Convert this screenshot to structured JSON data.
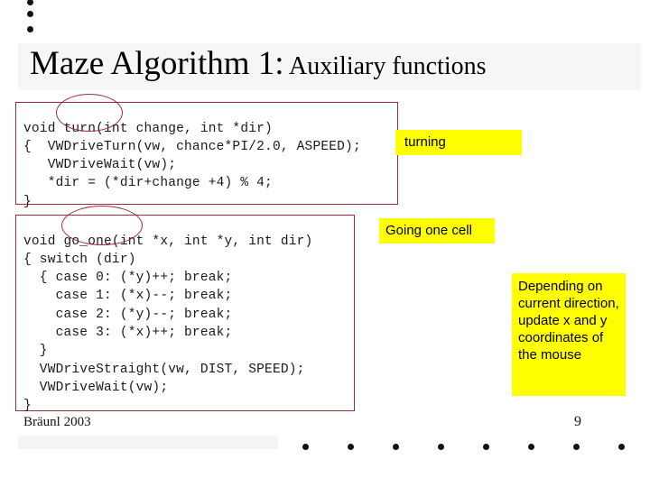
{
  "slide": {
    "title_main": "Maze Algorithm 1:",
    "title_sub": " Auxiliary functions"
  },
  "code_blocks": [
    {
      "name": "turn-function",
      "text": "void turn(int change, int *dir)\n{  VWDriveTurn(vw, chance*PI/2.0, ASPEED);\n   VWDriveWait(vw);\n   *dir = (*dir+change +4) % 4;\n}",
      "highlight_token": "turn("
    },
    {
      "name": "go-one-function",
      "text": "void go_one(int *x, int *y, int dir)\n{ switch (dir)\n  { case 0: (*y)++; break;\n    case 1: (*x)--; break;\n    case 2: (*y)--; break;\n    case 3: (*x)++; break;\n  }\n  VWDriveStraight(vw, DIST, SPEED);\n  VWDriveWait(vw);\n}",
      "highlight_token": "go_one("
    }
  ],
  "callouts": [
    {
      "name": "turning",
      "text": "turning"
    },
    {
      "name": "going-one-cell",
      "text": "Going one cell"
    },
    {
      "name": "depending-on-direction",
      "text": "Depending on current direction, update x and y coordinates of the mouse"
    }
  ],
  "footer": {
    "author": "Bräunl 2003",
    "page_number": "9"
  },
  "colors": {
    "annotation_red": "#9c2f38",
    "callout_yellow": "#ffff00",
    "band_grey": "#f6f6f7",
    "text_black": "#000000"
  },
  "decor": {
    "top_dots_count": 3,
    "bottom_dots_count": 8
  }
}
